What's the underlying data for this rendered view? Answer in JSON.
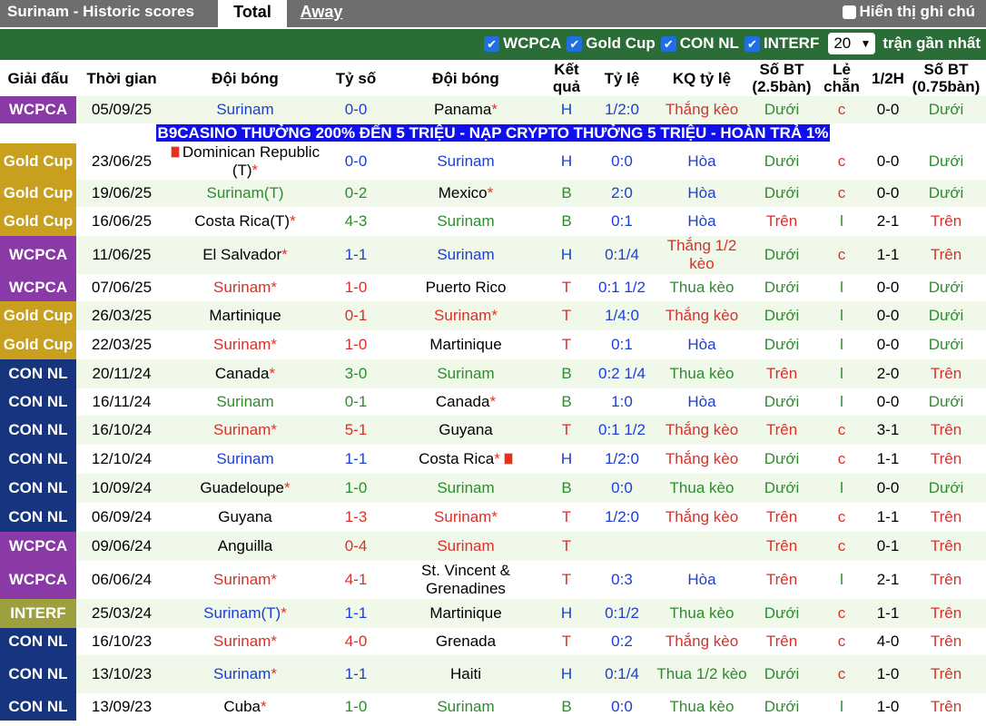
{
  "header": {
    "title": "Surinam - Historic scores",
    "tab_total": "Total",
    "tab_away": "Away",
    "notes_label": "Hiển thị ghi chú"
  },
  "filters": {
    "items": [
      "WCPCA",
      "Gold Cup",
      "CON NL",
      "INTERF"
    ],
    "count_value": "20",
    "count_label": "trận gần nhất"
  },
  "columns": {
    "league": "Giải đấu",
    "time": "Thời gian",
    "home": "Đội bóng",
    "score": "Tỷ số",
    "away": "Đội bóng",
    "result": "Kết quả",
    "odds": "Tỷ lệ",
    "odds_result": "KQ tỷ lệ",
    "ou_goals": "Số BT (2.5bàn)",
    "odd_even": "Lẻ chẵn",
    "half": "1/2H",
    "ou_goals_half": "Số BT (0.75bàn)"
  },
  "promo": "B9CASINO THƯỞNG 200% ĐẾN 5 TRIỆU - NẠP CRYPTO THƯỞNG 5 TRIỆU - HOÀN TRẢ 1%",
  "colors": {
    "WCPCA": "#8a3aa6",
    "Gold Cup": "#c8a01e",
    "CON NL": "#17347f",
    "INTERF": "#9da03c",
    "win": "#d9302a",
    "draw": "#1a3ed6",
    "loss": "#2e8b2e"
  },
  "rows": [
    {
      "league": "WCPCA",
      "date": "05/09/25",
      "home": "Surinam",
      "home_star": "",
      "away": "Panama",
      "away_star": "*",
      "score": "0-0",
      "res": "H",
      "odds": "1/2:0",
      "kq": "Thắng kèo",
      "ou": "Dưới",
      "oe": "c",
      "half": "0-0",
      "ou2": "Dưới"
    },
    {
      "league": "Gold Cup",
      "date": "23/06/25",
      "home": "Dominican Republic (T)",
      "home_star": "*",
      "away": "Surinam",
      "away_star": "",
      "score": "0-0",
      "res": "H",
      "odds": "0:0",
      "kq": "Hòa",
      "ou": "Dưới",
      "oe": "c",
      "half": "0-0",
      "ou2": "Dưới"
    },
    {
      "league": "Gold Cup",
      "date": "19/06/25",
      "home": "Surinam(T)",
      "home_star": "",
      "away": "Mexico",
      "away_star": "*",
      "score": "0-2",
      "res": "B",
      "odds": "2:0",
      "kq": "Hòa",
      "ou": "Dưới",
      "oe": "c",
      "half": "0-0",
      "ou2": "Dưới"
    },
    {
      "league": "Gold Cup",
      "date": "16/06/25",
      "home": "Costa Rica(T)",
      "home_star": "*",
      "away": "Surinam",
      "away_star": "",
      "score": "4-3",
      "res": "B",
      "odds": "0:1",
      "kq": "Hòa",
      "ou": "Trên",
      "oe": "l",
      "half": "2-1",
      "ou2": "Trên"
    },
    {
      "league": "WCPCA",
      "date": "11/06/25",
      "home": "El Salvador",
      "home_star": "*",
      "away": "Surinam",
      "away_star": "",
      "score": "1-1",
      "res": "H",
      "odds": "0:1/4",
      "kq": "Thắng 1/2 kèo",
      "ou": "Dưới",
      "oe": "c",
      "half": "1-1",
      "ou2": "Trên"
    },
    {
      "league": "WCPCA",
      "date": "07/06/25",
      "home": "Surinam",
      "home_star": "*",
      "away": "Puerto Rico",
      "away_star": "",
      "score": "1-0",
      "res": "T",
      "odds": "0:1 1/2",
      "kq": "Thua kèo",
      "ou": "Dưới",
      "oe": "l",
      "half": "0-0",
      "ou2": "Dưới"
    },
    {
      "league": "Gold Cup",
      "date": "26/03/25",
      "home": "Martinique",
      "home_star": "",
      "away": "Surinam",
      "away_star": "*",
      "score": "0-1",
      "res": "T",
      "odds": "1/4:0",
      "kq": "Thắng kèo",
      "ou": "Dưới",
      "oe": "l",
      "half": "0-0",
      "ou2": "Dưới"
    },
    {
      "league": "Gold Cup",
      "date": "22/03/25",
      "home": "Surinam",
      "home_star": "*",
      "away": "Martinique",
      "away_star": "",
      "score": "1-0",
      "res": "T",
      "odds": "0:1",
      "kq": "Hòa",
      "ou": "Dưới",
      "oe": "l",
      "half": "0-0",
      "ou2": "Dưới"
    },
    {
      "league": "CON NL",
      "date": "20/11/24",
      "home": "Canada",
      "home_star": "*",
      "away": "Surinam",
      "away_star": "",
      "score": "3-0",
      "res": "B",
      "odds": "0:2 1/4",
      "kq": "Thua kèo",
      "ou": "Trên",
      "oe": "l",
      "half": "2-0",
      "ou2": "Trên"
    },
    {
      "league": "CON NL",
      "date": "16/11/24",
      "home": "Surinam",
      "home_star": "",
      "away": "Canada",
      "away_star": "*",
      "score": "0-1",
      "res": "B",
      "odds": "1:0",
      "kq": "Hòa",
      "ou": "Dưới",
      "oe": "l",
      "half": "0-0",
      "ou2": "Dưới"
    },
    {
      "league": "CON NL",
      "date": "16/10/24",
      "home": "Surinam",
      "home_star": "*",
      "away": "Guyana",
      "away_star": "",
      "score": "5-1",
      "res": "T",
      "odds": "0:1 1/2",
      "kq": "Thắng kèo",
      "ou": "Trên",
      "oe": "c",
      "half": "3-1",
      "ou2": "Trên"
    },
    {
      "league": "CON NL",
      "date": "12/10/24",
      "home": "Surinam",
      "home_star": "",
      "away": "Costa Rica",
      "away_star": "*",
      "score": "1-1",
      "res": "H",
      "odds": "1/2:0",
      "kq": "Thắng kèo",
      "ou": "Dưới",
      "oe": "c",
      "half": "1-1",
      "ou2": "Trên"
    },
    {
      "league": "CON NL",
      "date": "10/09/24",
      "home": "Guadeloupe",
      "home_star": "*",
      "away": "Surinam",
      "away_star": "",
      "score": "1-0",
      "res": "B",
      "odds": "0:0",
      "kq": "Thua kèo",
      "ou": "Dưới",
      "oe": "l",
      "half": "0-0",
      "ou2": "Dưới"
    },
    {
      "league": "CON NL",
      "date": "06/09/24",
      "home": "Guyana",
      "home_star": "",
      "away": "Surinam",
      "away_star": "*",
      "score": "1-3",
      "res": "T",
      "odds": "1/2:0",
      "kq": "Thắng kèo",
      "ou": "Trên",
      "oe": "c",
      "half": "1-1",
      "ou2": "Trên"
    },
    {
      "league": "WCPCA",
      "date": "09/06/24",
      "home": "Anguilla",
      "home_star": "",
      "away": "Surinam",
      "away_star": "",
      "score": "0-4",
      "res": "T",
      "odds": "",
      "kq": "",
      "ou": "Trên",
      "oe": "c",
      "half": "0-1",
      "ou2": "Trên"
    },
    {
      "league": "WCPCA",
      "date": "06/06/24",
      "home": "Surinam",
      "home_star": "*",
      "away": "St. Vincent & Grenadines",
      "away_star": "",
      "score": "4-1",
      "res": "T",
      "odds": "0:3",
      "kq": "Hòa",
      "ou": "Trên",
      "oe": "l",
      "half": "2-1",
      "ou2": "Trên"
    },
    {
      "league": "INTERF",
      "date": "25/03/24",
      "home": "Surinam(T)",
      "home_star": "*",
      "away": "Martinique",
      "away_star": "",
      "score": "1-1",
      "res": "H",
      "odds": "0:1/2",
      "kq": "Thua kèo",
      "ou": "Dưới",
      "oe": "c",
      "half": "1-1",
      "ou2": "Trên"
    },
    {
      "league": "CON NL",
      "date": "16/10/23",
      "home": "Surinam",
      "home_star": "*",
      "away": "Grenada",
      "away_star": "",
      "score": "4-0",
      "res": "T",
      "odds": "0:2",
      "kq": "Thắng kèo",
      "ou": "Trên",
      "oe": "c",
      "half": "4-0",
      "ou2": "Trên"
    },
    {
      "league": "CON NL",
      "date": "13/10/23",
      "home": "Surinam",
      "home_star": "*",
      "away": "Haiti",
      "away_star": "",
      "score": "1-1",
      "res": "H",
      "odds": "0:1/4",
      "kq": "Thua 1/2 kèo",
      "ou": "Dưới",
      "oe": "c",
      "half": "1-0",
      "ou2": "Trên"
    },
    {
      "league": "CON NL",
      "date": "13/09/23",
      "home": "Cuba",
      "home_star": "*",
      "away": "Surinam",
      "away_star": "",
      "score": "1-0",
      "res": "B",
      "odds": "0:0",
      "kq": "Thua kèo",
      "ou": "Dưới",
      "oe": "l",
      "half": "1-0",
      "ou2": "Trên"
    }
  ]
}
